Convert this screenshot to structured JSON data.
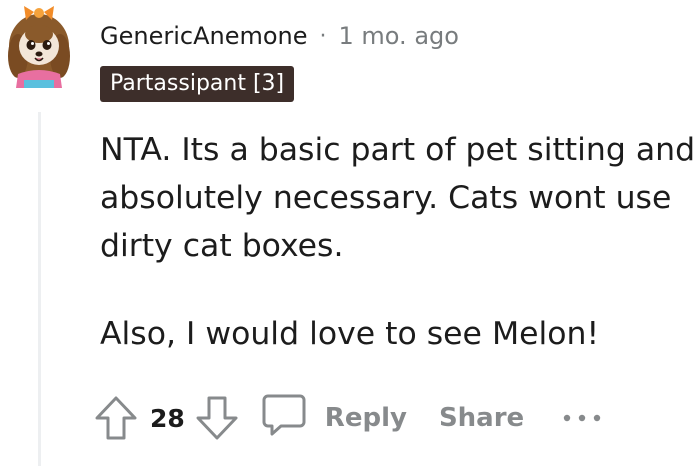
{
  "comment": {
    "author": "GenericAnemone",
    "separator": "·",
    "time": "1 mo. ago",
    "flair": "Partassipant [3]",
    "paragraphs": [
      "NTA. Its a basic part of pet sitting and\nabsolutely necessary. Cats wont use\ndirty cat boxes.",
      "Also, I would love to see Melon!"
    ],
    "score": "28"
  },
  "actions": {
    "reply_label": "Reply",
    "share_label": "Share"
  },
  "icons": {
    "upvote": "upvote-arrow-icon",
    "downvote": "downvote-arrow-icon",
    "reply": "speech-bubble-icon",
    "more": "more-options-icon",
    "avatar": "cartoon-dog-avatar"
  },
  "colors": {
    "flair_bg": "#3d2e2a",
    "flair_text": "#ffffff",
    "muted": "#878a8c",
    "text": "#1c1c1c",
    "thread_line": "#edeff1"
  }
}
